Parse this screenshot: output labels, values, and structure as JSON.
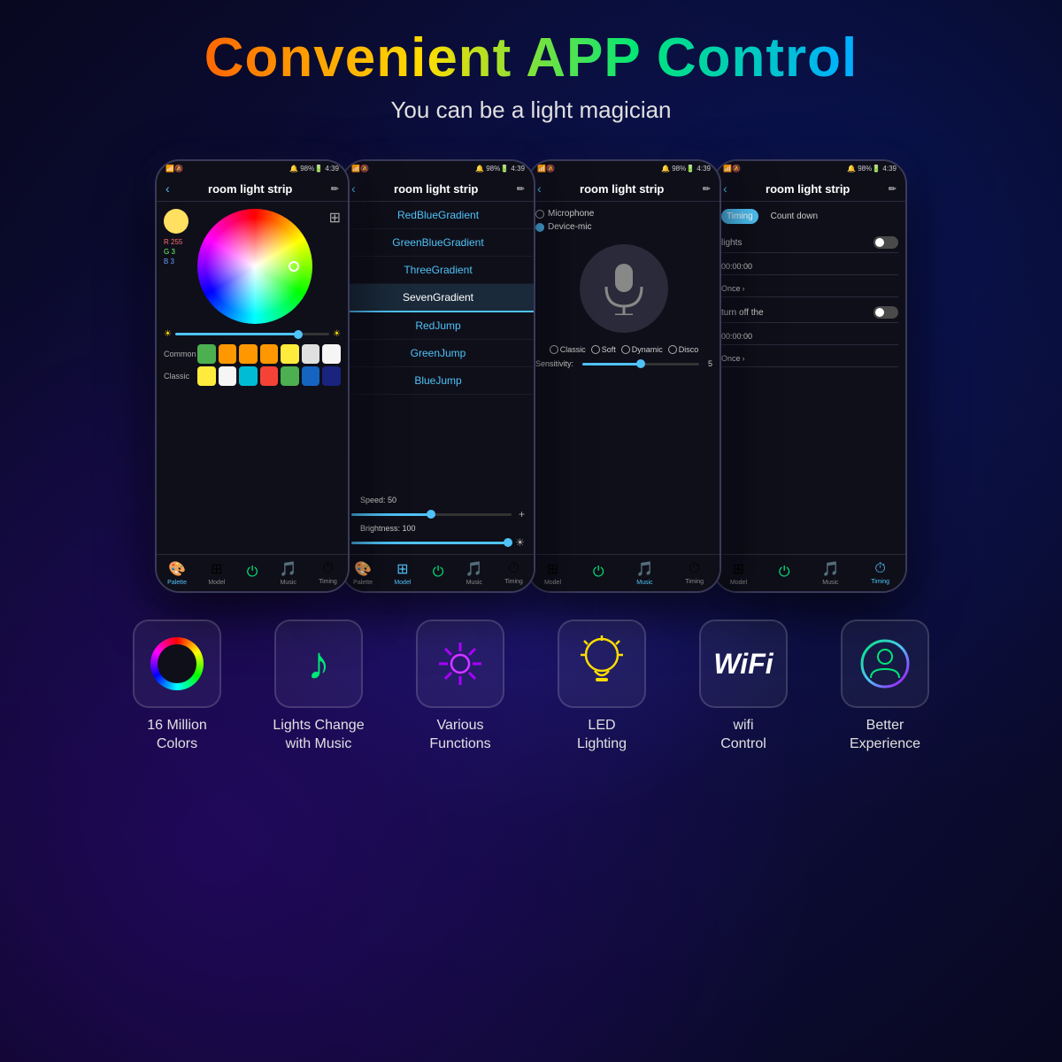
{
  "header": {
    "title": "Convenient APP Control",
    "subtitle": "You can be a light magician"
  },
  "phones": [
    {
      "id": "phone1",
      "statusBar": {
        "left": "📶🔕📶",
        "center": "🕐 98% 🔋",
        "time": "4:39"
      },
      "appTitle": "room light strip",
      "type": "palette",
      "rgb": {
        "r": "R 255",
        "g": "G 3",
        "b": "B 3"
      },
      "brightness": 80,
      "swatchRows": {
        "common": [
          "#4caf50",
          "#ff9800",
          "#ff9800",
          "#ff9800",
          "#ffeb3b",
          "#e0e0e0",
          "#f5f5f5"
        ],
        "classic": [
          "#ffeb3b",
          "#f5f5f5",
          "#00bcd4",
          "#f44336",
          "#4caf50",
          "#1565c0",
          "#1a237e"
        ]
      },
      "navItems": [
        "Palette",
        "Model",
        "Power",
        "Music",
        "Timing"
      ]
    },
    {
      "id": "phone2",
      "appTitle": "room light strip",
      "type": "modes",
      "modes": [
        "RedBlueGradient",
        "GreenBlueGradient",
        "ThreeGradient",
        "SevenGradient",
        "RedJump",
        "GreenJump",
        "BlueJump"
      ],
      "selectedMode": "SevenGradient",
      "speedValue": "50",
      "brightnessValue": "100",
      "navItems": [
        "Palette",
        "Model",
        "Power",
        "Music",
        "Timing"
      ]
    },
    {
      "id": "phone3",
      "appTitle": "room light strip",
      "type": "music",
      "micOptions": [
        "Microphone",
        "Device-mic"
      ],
      "selectedMic": "Device-mic",
      "musicModes": [
        "Classic",
        "Soft",
        "Dynamic",
        "Disco"
      ],
      "sensitivityValue": "5",
      "navItems": [
        "Model",
        "Power",
        "Music",
        "Timing"
      ]
    },
    {
      "id": "phone4",
      "appTitle": "room light strip",
      "type": "timing",
      "tabs": [
        "Timing",
        "Count down"
      ],
      "activeTab": "Timing",
      "rows": [
        {
          "label": "lights",
          "toggle": false,
          "time": "00:00:00",
          "repeat": "Once"
        },
        {
          "label": "turn off the",
          "toggle": false,
          "time": "00:00:00",
          "repeat": "Once"
        }
      ],
      "navItems": [
        "Model",
        "Power",
        "Music",
        "Timing"
      ]
    }
  ],
  "features": [
    {
      "id": "colors",
      "label": "16 Million\nColors",
      "icon": "ring"
    },
    {
      "id": "music",
      "label": "Lights Change\nwith Music",
      "icon": "music"
    },
    {
      "id": "functions",
      "label": "Various\nFunctions",
      "icon": "gear"
    },
    {
      "id": "led",
      "label": "LED\nLighting",
      "icon": "bulb"
    },
    {
      "id": "wifi",
      "label": "wifi\nControl",
      "icon": "wifi"
    },
    {
      "id": "experience",
      "label": "Better\nExperience",
      "icon": "person"
    }
  ]
}
